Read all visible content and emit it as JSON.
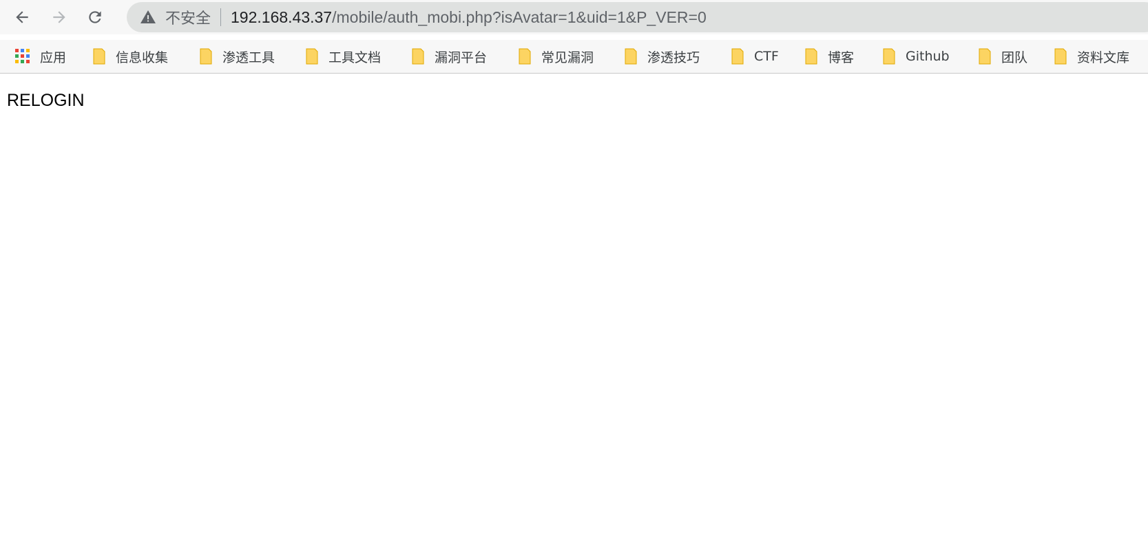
{
  "toolbar": {
    "back_icon": "arrow-left-icon",
    "forward_icon": "arrow-right-icon",
    "reload_icon": "reload-icon"
  },
  "omnibox": {
    "security_icon": "warning-triangle-icon",
    "security_label": "不安全",
    "url_host": "192.168.43.37",
    "url_path": "/mobile/auth_mobi.php?isAvatar=1&uid=1&P_VER=0"
  },
  "bookmarks": {
    "apps_label": "应用",
    "items": [
      {
        "label": "信息收集"
      },
      {
        "label": "渗透工具"
      },
      {
        "label": "工具文档"
      },
      {
        "label": "漏洞平台"
      },
      {
        "label": "常见漏洞"
      },
      {
        "label": "渗透技巧"
      },
      {
        "label": "CTF"
      },
      {
        "label": "博客"
      },
      {
        "label": "Github"
      },
      {
        "label": "团队"
      },
      {
        "label": "资料文库"
      }
    ]
  },
  "page": {
    "body_text": "RELOGIN"
  },
  "colors": {
    "omnibox_bg": "#dfe1e0",
    "folder_fill": "#fcd462",
    "folder_stroke": "#e0a800",
    "toolbar_bg": "#f7f7f7"
  }
}
